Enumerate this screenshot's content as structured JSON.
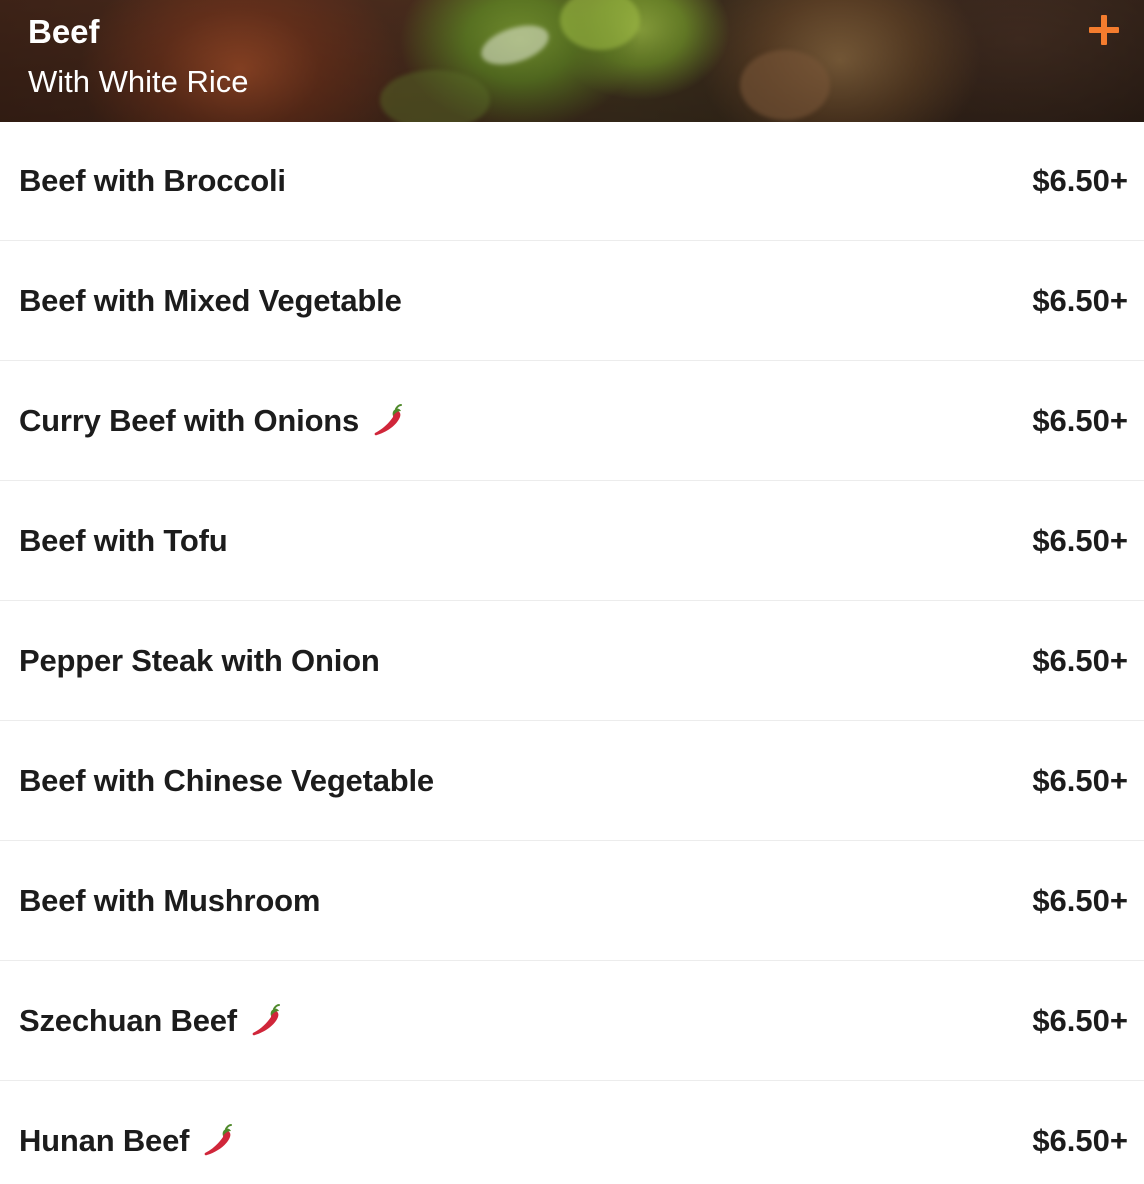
{
  "category": {
    "title": "Beef",
    "subtitle": "With White Rice",
    "add_icon": "plus-icon",
    "accent_color": "#f47c2e"
  },
  "items": [
    {
      "name": "Beef with Broccoli",
      "price": "$6.50+",
      "spicy": false
    },
    {
      "name": "Beef with Mixed Vegetable",
      "price": "$6.50+",
      "spicy": false
    },
    {
      "name": "Curry Beef with Onions",
      "price": "$6.50+",
      "spicy": true
    },
    {
      "name": "Beef with Tofu",
      "price": "$6.50+",
      "spicy": false
    },
    {
      "name": "Pepper Steak with Onion",
      "price": "$6.50+",
      "spicy": false
    },
    {
      "name": "Beef with Chinese Vegetable",
      "price": "$6.50+",
      "spicy": false
    },
    {
      "name": "Beef with Mushroom",
      "price": "$6.50+",
      "spicy": false
    },
    {
      "name": "Szechuan Beef",
      "price": "$6.50+",
      "spicy": true
    },
    {
      "name": "Hunan Beef",
      "price": "$6.50+",
      "spicy": true
    }
  ],
  "spicy_icon": "chili-pepper-icon",
  "spicy_color": "#d0263a"
}
